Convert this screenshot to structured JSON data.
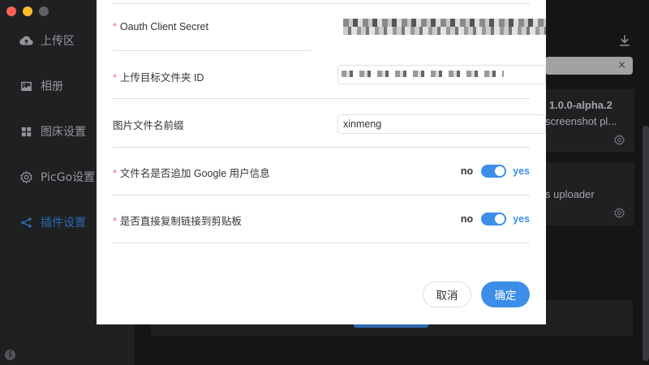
{
  "sidebar": {
    "items": [
      {
        "label": "上传区",
        "icon": "cloud-upload-icon"
      },
      {
        "label": "相册",
        "icon": "image-icon"
      },
      {
        "label": "图床设置",
        "icon": "grid-icon"
      },
      {
        "label": "PicGo设置",
        "icon": "gear-icon"
      },
      {
        "label": "插件设置",
        "icon": "share-icon"
      }
    ]
  },
  "background": {
    "plugin_card_1": {
      "version": "e 1.0.0-alpha.2",
      "desc": "screenshot pl..."
    },
    "plugin_card_2": {
      "desc": "s uploader"
    },
    "search_clear": "×"
  },
  "dialog": {
    "fields": [
      {
        "label": "Oauth Client Secret",
        "required": true,
        "value": ""
      },
      {
        "label": "上传目标文件夹 ID",
        "required": true,
        "value": ""
      },
      {
        "label": "图片文件名前缀",
        "required": false,
        "value": "xinmeng"
      },
      {
        "label": "文件名是否追加 Google 用户信息",
        "required": true,
        "off_text": "no",
        "on_text": "yes",
        "checked": true
      },
      {
        "label": "是否直接复制链接到剪贴板",
        "required": true,
        "off_text": "no",
        "on_text": "yes",
        "checked": true
      }
    ],
    "required_mark": "*",
    "cancel_label": "取消",
    "confirm_label": "确定"
  },
  "colors": {
    "accent": "#3d8ee8",
    "required": "#f56c6c",
    "sidebar_bg": "#2a2b2e"
  }
}
